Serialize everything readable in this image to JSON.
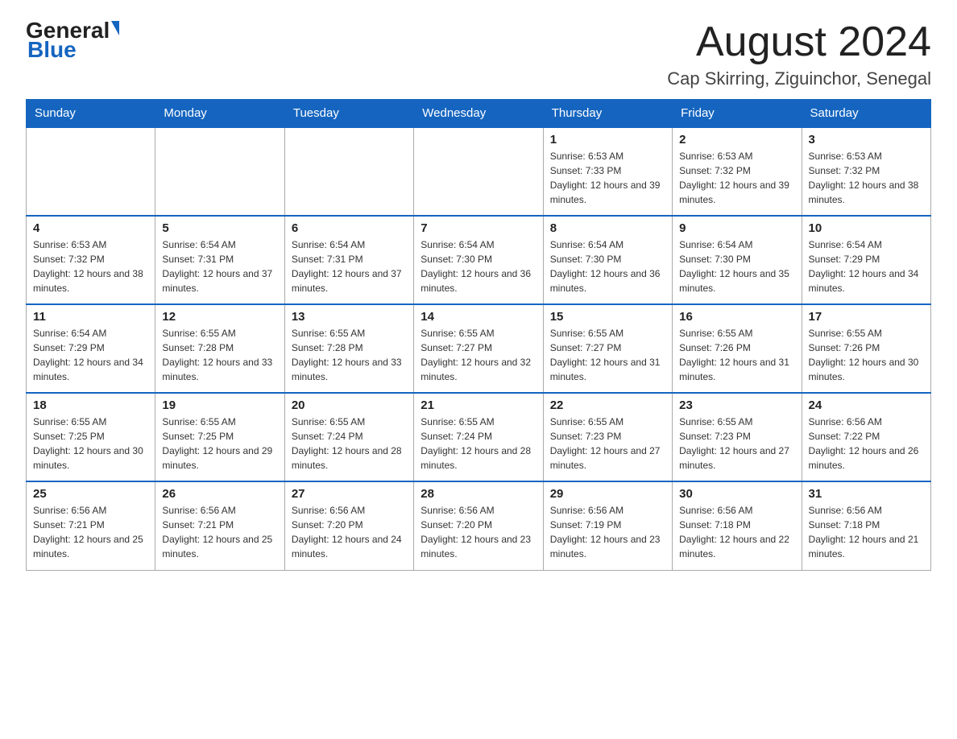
{
  "logo": {
    "general": "General",
    "blue": "Blue"
  },
  "header": {
    "month": "August 2024",
    "location": "Cap Skirring, Ziguinchor, Senegal"
  },
  "days_of_week": [
    "Sunday",
    "Monday",
    "Tuesday",
    "Wednesday",
    "Thursday",
    "Friday",
    "Saturday"
  ],
  "weeks": [
    [
      {
        "day": "",
        "info": ""
      },
      {
        "day": "",
        "info": ""
      },
      {
        "day": "",
        "info": ""
      },
      {
        "day": "",
        "info": ""
      },
      {
        "day": "1",
        "info": "Sunrise: 6:53 AM\nSunset: 7:33 PM\nDaylight: 12 hours and 39 minutes."
      },
      {
        "day": "2",
        "info": "Sunrise: 6:53 AM\nSunset: 7:32 PM\nDaylight: 12 hours and 39 minutes."
      },
      {
        "day": "3",
        "info": "Sunrise: 6:53 AM\nSunset: 7:32 PM\nDaylight: 12 hours and 38 minutes."
      }
    ],
    [
      {
        "day": "4",
        "info": "Sunrise: 6:53 AM\nSunset: 7:32 PM\nDaylight: 12 hours and 38 minutes."
      },
      {
        "day": "5",
        "info": "Sunrise: 6:54 AM\nSunset: 7:31 PM\nDaylight: 12 hours and 37 minutes."
      },
      {
        "day": "6",
        "info": "Sunrise: 6:54 AM\nSunset: 7:31 PM\nDaylight: 12 hours and 37 minutes."
      },
      {
        "day": "7",
        "info": "Sunrise: 6:54 AM\nSunset: 7:30 PM\nDaylight: 12 hours and 36 minutes."
      },
      {
        "day": "8",
        "info": "Sunrise: 6:54 AM\nSunset: 7:30 PM\nDaylight: 12 hours and 36 minutes."
      },
      {
        "day": "9",
        "info": "Sunrise: 6:54 AM\nSunset: 7:30 PM\nDaylight: 12 hours and 35 minutes."
      },
      {
        "day": "10",
        "info": "Sunrise: 6:54 AM\nSunset: 7:29 PM\nDaylight: 12 hours and 34 minutes."
      }
    ],
    [
      {
        "day": "11",
        "info": "Sunrise: 6:54 AM\nSunset: 7:29 PM\nDaylight: 12 hours and 34 minutes."
      },
      {
        "day": "12",
        "info": "Sunrise: 6:55 AM\nSunset: 7:28 PM\nDaylight: 12 hours and 33 minutes."
      },
      {
        "day": "13",
        "info": "Sunrise: 6:55 AM\nSunset: 7:28 PM\nDaylight: 12 hours and 33 minutes."
      },
      {
        "day": "14",
        "info": "Sunrise: 6:55 AM\nSunset: 7:27 PM\nDaylight: 12 hours and 32 minutes."
      },
      {
        "day": "15",
        "info": "Sunrise: 6:55 AM\nSunset: 7:27 PM\nDaylight: 12 hours and 31 minutes."
      },
      {
        "day": "16",
        "info": "Sunrise: 6:55 AM\nSunset: 7:26 PM\nDaylight: 12 hours and 31 minutes."
      },
      {
        "day": "17",
        "info": "Sunrise: 6:55 AM\nSunset: 7:26 PM\nDaylight: 12 hours and 30 minutes."
      }
    ],
    [
      {
        "day": "18",
        "info": "Sunrise: 6:55 AM\nSunset: 7:25 PM\nDaylight: 12 hours and 30 minutes."
      },
      {
        "day": "19",
        "info": "Sunrise: 6:55 AM\nSunset: 7:25 PM\nDaylight: 12 hours and 29 minutes."
      },
      {
        "day": "20",
        "info": "Sunrise: 6:55 AM\nSunset: 7:24 PM\nDaylight: 12 hours and 28 minutes."
      },
      {
        "day": "21",
        "info": "Sunrise: 6:55 AM\nSunset: 7:24 PM\nDaylight: 12 hours and 28 minutes."
      },
      {
        "day": "22",
        "info": "Sunrise: 6:55 AM\nSunset: 7:23 PM\nDaylight: 12 hours and 27 minutes."
      },
      {
        "day": "23",
        "info": "Sunrise: 6:55 AM\nSunset: 7:23 PM\nDaylight: 12 hours and 27 minutes."
      },
      {
        "day": "24",
        "info": "Sunrise: 6:56 AM\nSunset: 7:22 PM\nDaylight: 12 hours and 26 minutes."
      }
    ],
    [
      {
        "day": "25",
        "info": "Sunrise: 6:56 AM\nSunset: 7:21 PM\nDaylight: 12 hours and 25 minutes."
      },
      {
        "day": "26",
        "info": "Sunrise: 6:56 AM\nSunset: 7:21 PM\nDaylight: 12 hours and 25 minutes."
      },
      {
        "day": "27",
        "info": "Sunrise: 6:56 AM\nSunset: 7:20 PM\nDaylight: 12 hours and 24 minutes."
      },
      {
        "day": "28",
        "info": "Sunrise: 6:56 AM\nSunset: 7:20 PM\nDaylight: 12 hours and 23 minutes."
      },
      {
        "day": "29",
        "info": "Sunrise: 6:56 AM\nSunset: 7:19 PM\nDaylight: 12 hours and 23 minutes."
      },
      {
        "day": "30",
        "info": "Sunrise: 6:56 AM\nSunset: 7:18 PM\nDaylight: 12 hours and 22 minutes."
      },
      {
        "day": "31",
        "info": "Sunrise: 6:56 AM\nSunset: 7:18 PM\nDaylight: 12 hours and 21 minutes."
      }
    ]
  ]
}
